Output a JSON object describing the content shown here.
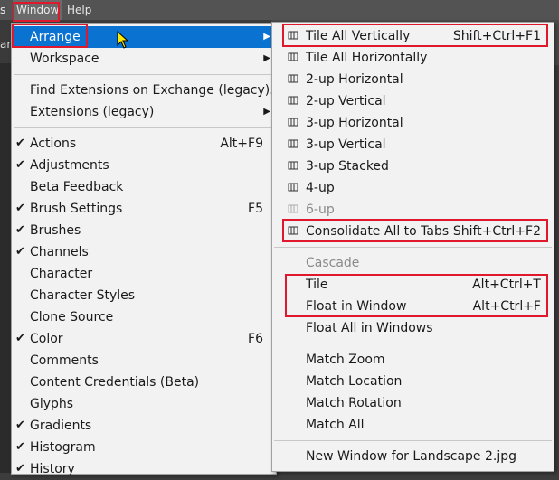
{
  "menubar": {
    "left_frag": "s",
    "window": "Window",
    "help": "Help",
    "side_frag": "ar"
  },
  "window_menu": {
    "items": [
      {
        "label": "Arrange",
        "submenu": true,
        "highlighted": true
      },
      {
        "label": "Workspace",
        "submenu": true
      },
      {
        "separator": true
      },
      {
        "label": "Find Extensions on Exchange (legacy)..."
      },
      {
        "label": "Extensions (legacy)",
        "submenu": true
      },
      {
        "separator": true
      },
      {
        "label": "Actions",
        "checked": true,
        "shortcut": "Alt+F9"
      },
      {
        "label": "Adjustments",
        "checked": true
      },
      {
        "label": "Beta Feedback"
      },
      {
        "label": "Brush Settings",
        "checked": true,
        "shortcut": "F5"
      },
      {
        "label": "Brushes",
        "checked": true
      },
      {
        "label": "Channels",
        "checked": true
      },
      {
        "label": "Character"
      },
      {
        "label": "Character Styles"
      },
      {
        "label": "Clone Source"
      },
      {
        "label": "Color",
        "checked": true,
        "shortcut": "F6"
      },
      {
        "label": "Comments"
      },
      {
        "label": "Content Credentials (Beta)"
      },
      {
        "label": "Glyphs"
      },
      {
        "label": "Gradients",
        "checked": true
      },
      {
        "label": "Histogram",
        "checked": true
      },
      {
        "label": "History",
        "checked": true
      }
    ]
  },
  "arrange_menu": {
    "items": [
      {
        "label": "Tile All Vertically",
        "shortcut": "Shift+Ctrl+F1",
        "icon": "tile-vertical-icon"
      },
      {
        "label": "Tile All Horizontally",
        "icon": "tile-horizontal-icon"
      },
      {
        "label": "2-up Horizontal",
        "icon": "two-up-horizontal-icon"
      },
      {
        "label": "2-up Vertical",
        "icon": "two-up-vertical-icon"
      },
      {
        "label": "3-up Horizontal",
        "icon": "three-up-horizontal-icon"
      },
      {
        "label": "3-up Vertical",
        "icon": "three-up-vertical-icon"
      },
      {
        "label": "3-up Stacked",
        "icon": "three-up-stacked-icon"
      },
      {
        "label": "4-up",
        "icon": "four-up-icon"
      },
      {
        "label": "6-up",
        "icon": "six-up-icon",
        "disabled": true
      },
      {
        "label": "Consolidate All to Tabs",
        "shortcut": "Shift+Ctrl+F2",
        "icon": "consolidate-tabs-icon"
      },
      {
        "separator": true
      },
      {
        "label": "Cascade",
        "disabled": true
      },
      {
        "label": "Tile",
        "shortcut": "Alt+Ctrl+T"
      },
      {
        "label": "Float in Window",
        "shortcut": "Alt+Ctrl+F"
      },
      {
        "label": "Float All in Windows"
      },
      {
        "separator": true
      },
      {
        "label": "Match Zoom"
      },
      {
        "label": "Match Location"
      },
      {
        "label": "Match Rotation"
      },
      {
        "label": "Match All"
      },
      {
        "separator": true
      },
      {
        "label": "New Window for Landscape 2.jpg"
      }
    ]
  },
  "colors": {
    "highlight": "#0a72d1",
    "annotation_red": "#e0182d",
    "menu_bg": "#f2f2f2"
  }
}
